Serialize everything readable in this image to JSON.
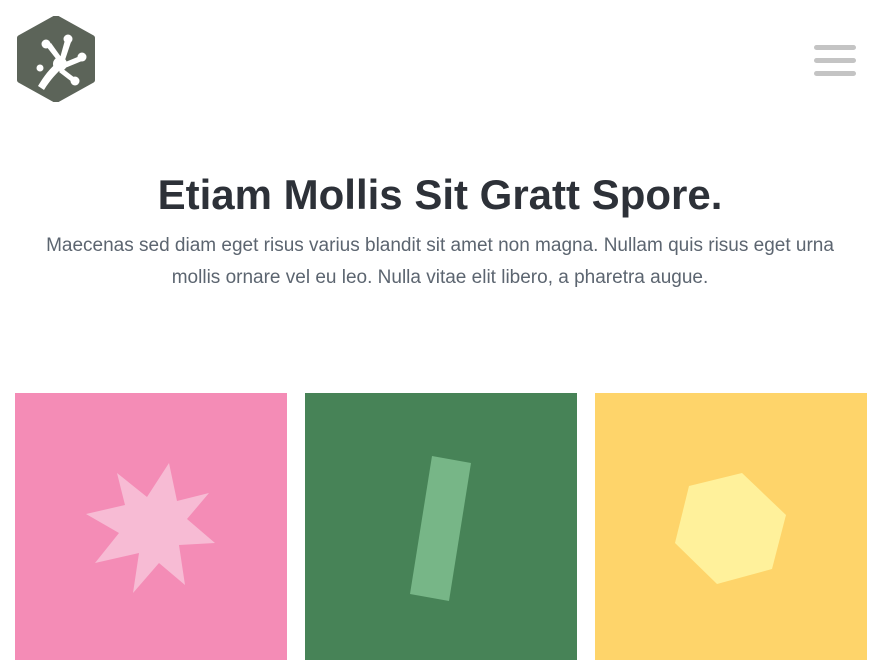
{
  "header": {
    "logo_icon": "frog-hand-hexagon-icon",
    "menu_icon": "hamburger-menu-icon"
  },
  "hero": {
    "title": "Etiam Mollis Sit Gratt Spore.",
    "text": "Maecenas sed diam eget risus varius blandit sit amet non magna. Nullam quis risus eget urna mollis ornare vel eu leo. Nulla vitae elit libero, a pharetra augue."
  },
  "cards": [
    {
      "shape": "star-icon",
      "background": "#f48cb6",
      "shape_color": "#f7bbd4"
    },
    {
      "shape": "rectangle-icon",
      "background": "#478357",
      "shape_color": "#77b687"
    },
    {
      "shape": "hexagon-icon",
      "background": "#fed46a",
      "shape_color": "#fff19b"
    }
  ],
  "colors": {
    "logo": "#5c6459",
    "menu": "#c4c4c4",
    "title": "#2d3138",
    "text": "#5c6570"
  }
}
